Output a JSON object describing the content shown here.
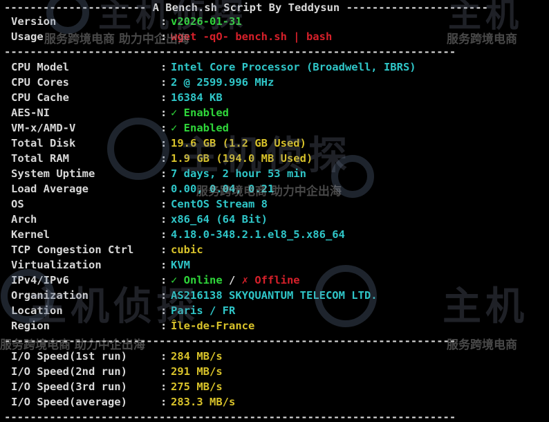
{
  "header": {
    "title": "A Bench.sh Script By Teddysun",
    "sep_left": "---------------------- ",
    "sep_right": " ----------------------"
  },
  "version": {
    "label": "Version",
    "value": "v2026-01-31"
  },
  "usage": {
    "label": "Usage",
    "value": "wget -qO- bench.sh | bash"
  },
  "separator": "----------------------------------------------------------------------",
  "system_info": [
    {
      "label": "CPU Model",
      "value": "Intel Core Processor (Broadwell, IBRS)",
      "color": "#2fc6c8"
    },
    {
      "label": "CPU Cores",
      "value": "2 @ 2599.996 MHz",
      "color": "#2fc6c8"
    },
    {
      "label": "CPU Cache",
      "value": "16384 KB",
      "color": "#2fc6c8"
    },
    {
      "label": "AES-NI",
      "value": "✓ Enabled",
      "color": "#2fd63a"
    },
    {
      "label": "VM-x/AMD-V",
      "value": "✓ Enabled",
      "color": "#2fd63a"
    },
    {
      "label": "Total Disk",
      "value": "19.6 GB (1.2 GB Used)",
      "color": "#d8c22a"
    },
    {
      "label": "Total RAM",
      "value": "1.9 GB (194.0 MB Used)",
      "color": "#d8c22a"
    },
    {
      "label": "System Uptime",
      "value": "7 days, 2 hour 53 min",
      "color": "#2fc6c8"
    },
    {
      "label": "Load Average",
      "value": "0.00, 0.04, 0.21",
      "color": "#2fc6c8"
    },
    {
      "label": "OS",
      "value": "CentOS Stream 8",
      "color": "#2fc6c8"
    },
    {
      "label": "Arch",
      "value": "x86_64 (64 Bit)",
      "color": "#2fc6c8"
    },
    {
      "label": "Kernel",
      "value": "4.18.0-348.2.1.el8_5.x86_64",
      "color": "#2fc6c8"
    },
    {
      "label": "TCP Congestion Ctrl",
      "value": "cubic",
      "color": "#d8c22a"
    }
  ],
  "virtualization": {
    "label": "Virtualization",
    "value": "KVM"
  },
  "ipv": {
    "label": "IPv4/IPv6",
    "online": "✓ Online",
    "slash": " / ",
    "offline": "✗ Offline"
  },
  "organization": {
    "label": "Organization",
    "value": "AS216138 SKYQUANTUM TELECOM LTD."
  },
  "location": {
    "label": "Location",
    "value": "Paris / FR"
  },
  "region": {
    "label": "Region",
    "value": "Île-de-France"
  },
  "io_speed": [
    {
      "label": "I/O Speed(1st run)",
      "value": "284 MB/s"
    },
    {
      "label": "I/O Speed(2nd run)",
      "value": "291 MB/s"
    },
    {
      "label": "I/O Speed(3rd run)",
      "value": "275 MB/s"
    },
    {
      "label": "I/O Speed(average)",
      "value": "283.3 MB/s"
    }
  ],
  "colon": ":",
  "colors": {
    "background": "#000000",
    "text": "#d8d8d8",
    "green": "#2fd63a",
    "red": "#d6202a",
    "cyan": "#2fc6c8",
    "yellow": "#d8c22a"
  },
  "watermark": {
    "slogan": "服务跨境电商 助力中企出海",
    "slogan_short": "服务跨境电商",
    "logo_text": "主机侦探",
    "logo_text_partial": "主机"
  }
}
